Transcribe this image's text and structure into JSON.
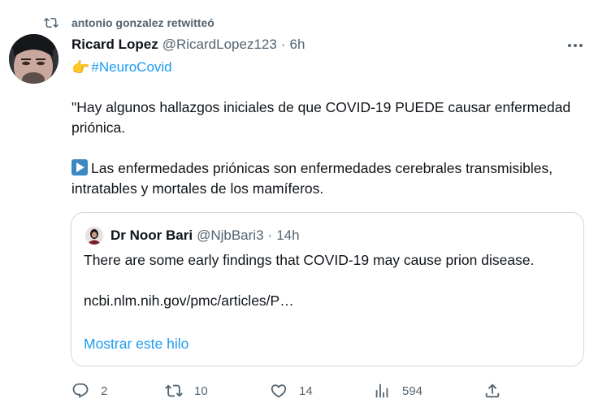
{
  "retweet": {
    "icon": "retweet-icon",
    "text": "antonio gonzalez retwitteó"
  },
  "tweet": {
    "author_name": "Ricard Lopez",
    "handle": "@RicardLopez123",
    "separator": "·",
    "time": "6h",
    "more_icon": "more-options-icon",
    "emoji": "👉",
    "hashtag": "#NeuroCovid",
    "paragraph1": "\"Hay algunos hallazgos iniciales de que COVID-19 PUEDE causar enfermedad priónica.",
    "paragraph2_icon": "play-button-icon",
    "paragraph2": "Las enfermedades priónicas son enfermedades cerebrales transmisibles, intratables y mortales de los mamíferos."
  },
  "quote": {
    "author_name": "Dr Noor Bari",
    "handle": "@NjbBari3",
    "separator": "·",
    "time": "14h",
    "text": "There are some early findings that COVID-19 may cause prion disease.",
    "link": "ncbi.nlm.nih.gov/pmc/articles/P…",
    "show_thread": "Mostrar este hilo"
  },
  "actions": {
    "reply": {
      "icon": "reply-icon",
      "count": "2"
    },
    "retweet": {
      "icon": "retweet-icon",
      "count": "10"
    },
    "like": {
      "icon": "like-icon",
      "count": "14"
    },
    "views": {
      "icon": "views-icon",
      "count": "594"
    },
    "share": {
      "icon": "share-icon"
    }
  },
  "colors": {
    "accent": "#1d9bf0",
    "muted": "#536471",
    "text": "#0f1419",
    "border": "#cfd9de"
  }
}
